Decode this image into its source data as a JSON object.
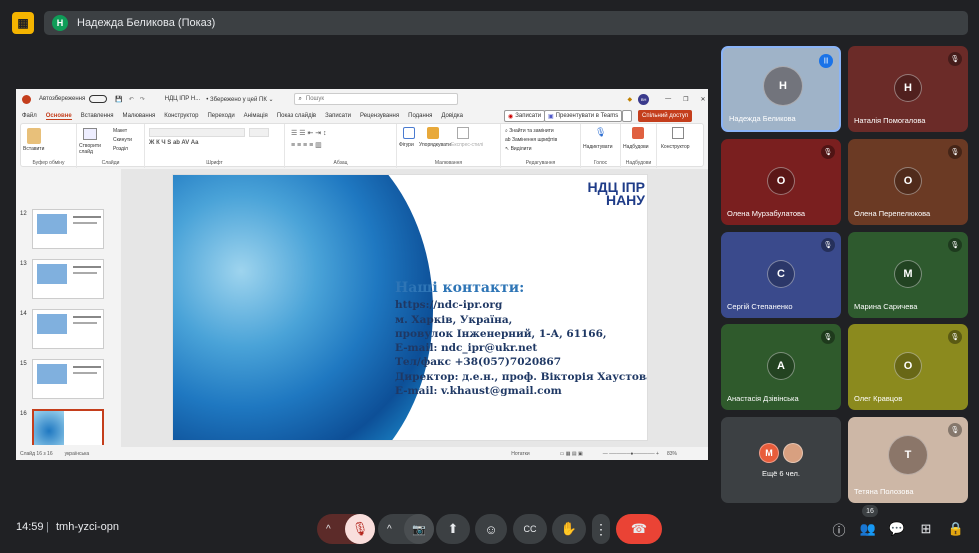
{
  "meeting": {
    "presenter_banner": "Надежда Беликова (Показ)",
    "presenter_initial": "Н",
    "time": "14:59",
    "code": "tmh-yzci-opn",
    "participants_count": "16"
  },
  "ppt": {
    "autosave_label": "Автозбереження",
    "file_name": "НДЦ ІПР Н...",
    "saved_status": "• Збережено у цей ПК ⌄",
    "search_placeholder": "Пошук",
    "user_initials": "BH",
    "menu": [
      "Файл",
      "Основне",
      "Вставлення",
      "Малювання",
      "Конструктор",
      "Переходи",
      "Анімація",
      "Показ слайдів",
      "Записати",
      "Рецензування",
      "Подання",
      "Довідка"
    ],
    "active_menu": "Основне",
    "record_btn": "Записати",
    "teams_btn": "Презентувати в Teams",
    "share_btn": "Спільний доступ",
    "ribbon": {
      "clipboard": {
        "paste": "Вставити",
        "label": "Буфер обміну"
      },
      "slides": {
        "new": "Створити слайд",
        "layout": "Макет",
        "reset": "Скинути",
        "section": "Розділ",
        "label": "Слайди"
      },
      "font": {
        "label": "Шрифт"
      },
      "paragraph": {
        "label": "Абзац"
      },
      "drawing": {
        "shapes": "Фігури",
        "arrange": "Упорядкувати",
        "styles": "Експрес-стилі",
        "label": "Малювання"
      },
      "editing": {
        "find": "Знайти та замінити",
        "replace_fonts": "Замінення шрифтів",
        "select": "Виділити",
        "label": "Редагування"
      },
      "voice": {
        "dictate": "Надиктувати",
        "label": "Голос"
      },
      "addins": {
        "addins": "Надбудови",
        "label": "Надбудови"
      },
      "designer": {
        "designer": "Конструктор"
      }
    },
    "thumb_numbers": [
      "12",
      "13",
      "14",
      "15",
      "16"
    ],
    "status": {
      "slide": "Слайд 16 з 16",
      "lang": "українська",
      "notes": "Нотатки",
      "zoom": "83%"
    },
    "slide": {
      "logo_line1": "НДЦ ІПР",
      "logo_line2": "НАНУ",
      "heading": "Наші контакти:",
      "lines": [
        "https://ndc-ipr.org",
        "м. Харків, Україна,",
        "провулок Інженерний, 1-А, 61166,",
        "E-mail: ndc_ipr@ukr.net",
        "Тел/факс +38(057)7020867",
        "Директор: д.е.н., проф. Вікторія Хаустова",
        "E-mail: v.khaust@gmail.com"
      ]
    }
  },
  "participants": [
    {
      "name": "Надежда Беликова",
      "bg": "#9fb3c8",
      "initial": "Н",
      "mic": "speaking"
    },
    {
      "name": "Наталія Помогалова",
      "bg": "#6b2b28",
      "initial": "Н",
      "mic": "muted"
    },
    {
      "name": "Олена Мурзабулатова",
      "bg": "#7a1f1f",
      "initial": "О",
      "mic": "muted"
    },
    {
      "name": "Олена Перепелюкова",
      "bg": "#6b3a24",
      "initial": "О",
      "mic": "muted"
    },
    {
      "name": "Сергій Степаненко",
      "bg": "#3a4a8c",
      "initial": "С",
      "mic": "muted"
    },
    {
      "name": "Марина Саричева",
      "bg": "#2e5a2e",
      "initial": "М",
      "mic": "muted"
    },
    {
      "name": "Анастасія Дзівінська",
      "bg": "#2f5a2c",
      "initial": "А",
      "mic": "muted"
    },
    {
      "name": "Олег Кравцов",
      "bg": "#8b8a1e",
      "initial": "О",
      "mic": "muted"
    },
    {
      "name": "Ещё 6 чел.",
      "bg": "#3c4043",
      "initial": "M",
      "mic": ""
    },
    {
      "name": "Тетяна Полозова",
      "bg": "#cdb7a6",
      "initial": "Т",
      "mic": "muted"
    }
  ],
  "icons": {
    "mic_off": "🎙",
    "camera": "📷",
    "present": "⬆",
    "emoji": "☺",
    "captions": "CC",
    "hand": "✋",
    "more": "⋮",
    "hangup": "☎",
    "info": "ⓘ",
    "people": "👥",
    "chat": "💬",
    "activities": "⊞",
    "lock": "🔒"
  },
  "colors": {
    "hangup": "#ea4335",
    "mic_off_bg": "#f9dedc",
    "ppt_accent": "#c43e1c"
  }
}
